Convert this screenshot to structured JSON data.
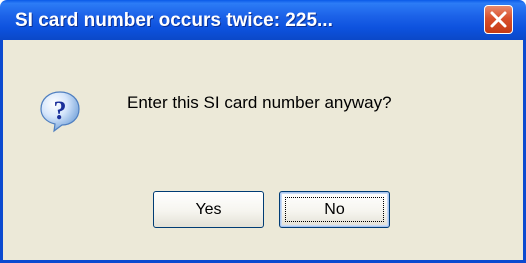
{
  "dialog": {
    "title": "SI card number occurs twice: 225...",
    "message": "Enter this SI card number anyway?",
    "icon": "question-icon",
    "buttons": {
      "yes_label": "Yes",
      "no_label": "No"
    },
    "focused_button": "No"
  },
  "colors": {
    "titlebar": "#1c62e8",
    "client_background": "#ece9d8",
    "close_button": "#d9502c",
    "border": "#0b4ad0"
  }
}
